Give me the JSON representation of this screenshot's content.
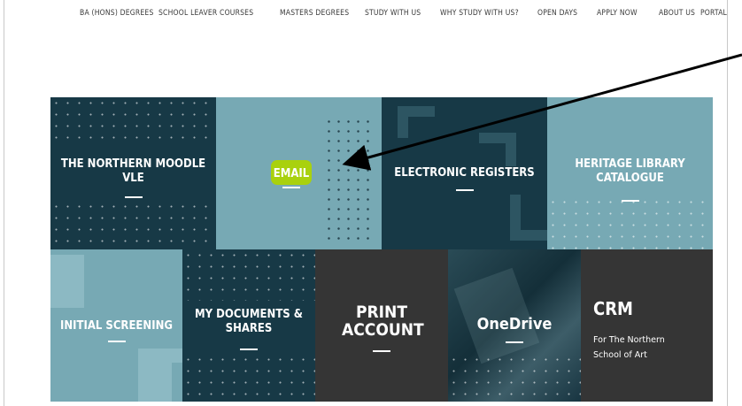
{
  "nav": {
    "items": [
      "BA (HONS) DEGREES",
      "SCHOOL LEAVER COURSES",
      "MASTERS DEGREES",
      "STUDY WITH US",
      "WHY STUDY WITH US?",
      "OPEN DAYS",
      "APPLY NOW",
      "ABOUT US",
      "PORTAL"
    ]
  },
  "tiles": {
    "moodle": {
      "label": "THE NORTHERN MOODLE VLE"
    },
    "email": {
      "label": "EMAIL"
    },
    "registers": {
      "label": "ELECTRONIC REGISTERS"
    },
    "heritage": {
      "label": "HERITAGE LIBRARY CATALOGUE"
    },
    "screening": {
      "label": "INITIAL SCREENING"
    },
    "documents": {
      "label": "MY DOCUMENTS & SHARES"
    },
    "print": {
      "label": "PRINT ACCOUNT"
    },
    "onedrive": {
      "label": "OneDrive"
    },
    "crm": {
      "label": "CRM",
      "subtitle": "For The Northern School of Art"
    }
  },
  "colors": {
    "dark_navy": "#173946",
    "teal_light": "#77a9b4",
    "charcoal": "#353535",
    "highlight": "#a9d10e",
    "annotation_arrow": "#000000"
  }
}
